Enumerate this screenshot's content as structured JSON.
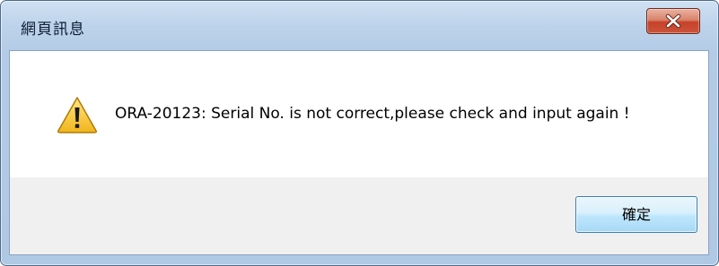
{
  "window": {
    "title": "網頁訊息"
  },
  "titlebar": {
    "close_icon": "close-icon"
  },
  "dialog": {
    "icon": "warning-icon",
    "message": "ORA-20123: Serial No. is not correct,please check and input again !",
    "ok_label": "確定"
  },
  "colors": {
    "close_button": "#c8412a",
    "ok_button_border": "#3c7fb1",
    "warning_fill": "#f7c62f"
  }
}
